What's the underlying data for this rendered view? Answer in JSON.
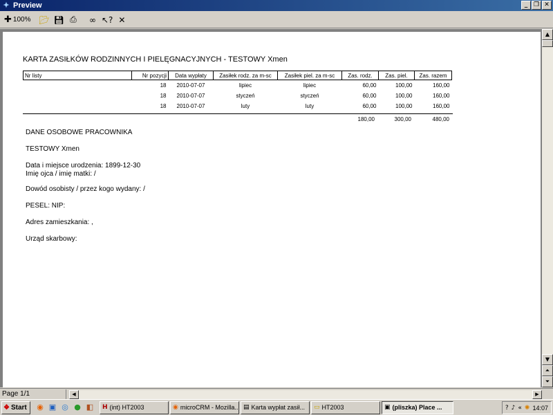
{
  "window": {
    "title": "Preview"
  },
  "toolbar": {
    "zoom_label": "100%"
  },
  "status": {
    "page": "Page 1/1"
  },
  "report": {
    "title": "KARTA ZASIŁKÓW RODZINNYCH I PIELĘGNACYJNYCH - TESTOWY Xmen",
    "columns": [
      "Nr listy",
      "Nr pozycji",
      "Data wypłaty",
      "Zasiłek rodz. za m-sc",
      "Zasiłek piel. za m-sc",
      "Zas. rodz.",
      "Zas. piel.",
      "Zas. razem"
    ],
    "rows": [
      [
        "",
        "18",
        "2010-07-07",
        "lipiec",
        "lipiec",
        "60,00",
        "100,00",
        "160,00"
      ],
      [
        "",
        "18",
        "2010-07-07",
        "styczeń",
        "styczeń",
        "60,00",
        "100,00",
        "160,00"
      ],
      [
        "",
        "18",
        "2010-07-07",
        "luty",
        "luty",
        "60,00",
        "100,00",
        "160,00"
      ]
    ],
    "totals": {
      "rodz": "180,00",
      "piel": "300,00",
      "razem": "480,00"
    },
    "section_heading": "DANE OSOBOWE PRACOWNIKA",
    "employee_name": "TESTOWY Xmen",
    "birth": "Data i miejsce urodzenia: 1899-12-30",
    "parents": "Imię ojca / imię matki: /",
    "id_card": "Dowód osobisty / przez kogo wydany:  /",
    "pesel": "PESEL:     NIP:",
    "address": "Adres zamieszkania: ,",
    "tax_office": "Urząd skarbowy:"
  },
  "taskbar": {
    "start_label": "Start",
    "tasks": [
      {
        "label": "(int)  HT2003"
      },
      {
        "label": "microCRM - Mozilla..."
      },
      {
        "label": "Karta wypłat zasił..."
      },
      {
        "label": "HT2003"
      },
      {
        "label": "(pliszka)  Place ..."
      }
    ],
    "clock": "14:07",
    "tray_arrows": "«"
  }
}
